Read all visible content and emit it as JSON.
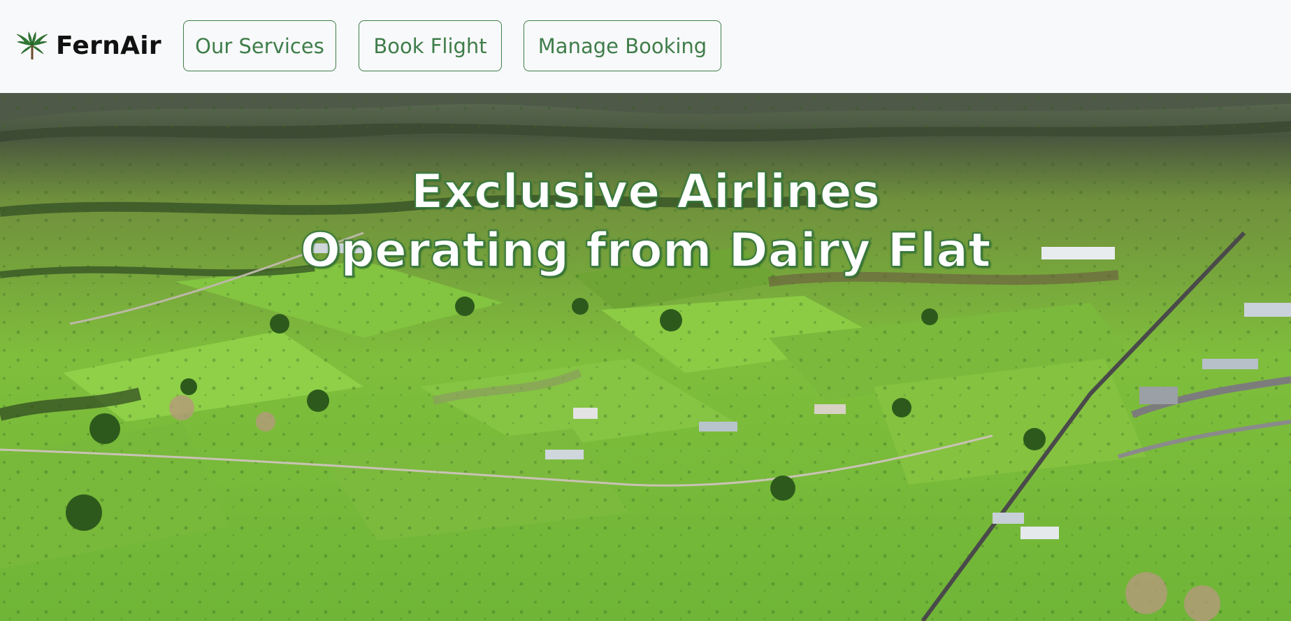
{
  "brand": {
    "name": "FernAir",
    "logo_icon": "fern-icon",
    "logo_color": "#2f7a33"
  },
  "nav": {
    "items": [
      {
        "label": "Our Services"
      },
      {
        "label": "Book Flight"
      },
      {
        "label": "Manage Booking"
      }
    ],
    "accent_color": "#3f7d4a"
  },
  "hero": {
    "heading_line1": "Exclusive Airlines",
    "heading_line2": "Operating from Dairy Flat",
    "image_subject": "aerial-farmland-airfield"
  }
}
